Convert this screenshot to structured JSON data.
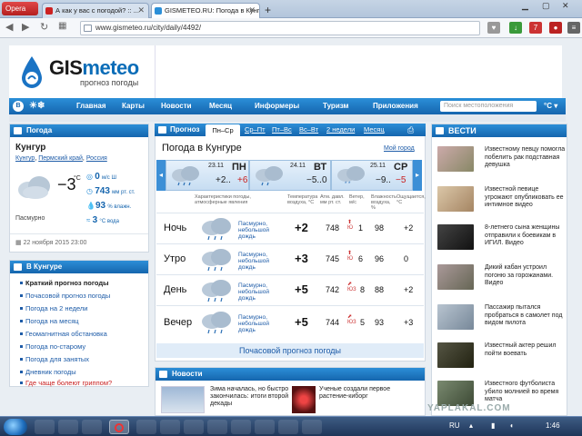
{
  "browser": {
    "opera_label": "Opera",
    "tabs": [
      {
        "title": "А как у вас с погодой? :: ..."
      },
      {
        "title": "GISMETEO.RU: Погода в Кунгуре"
      }
    ],
    "url": "www.gismeteo.ru/city/daily/4492/",
    "new_tab": "+",
    "ext_badge": "7"
  },
  "site": {
    "logo_main": "GIS",
    "logo_accent": "meteo",
    "logo_sub": "прогноз погоды",
    "menu": [
      "Главная",
      "Карты",
      "Новости",
      "Месяц",
      "Информеры",
      "Туризм",
      "Приложения"
    ],
    "search_placeholder": "Поиск местоположения",
    "unit_select": "°C ▾"
  },
  "current": {
    "header": "Погода",
    "city": "Кунгур",
    "region_links": [
      "Кунгур",
      "Пермский край",
      "Россия"
    ],
    "temp": "−3",
    "temp_unit": "°C",
    "wind_value": "0",
    "wind_unit": "м/с  Ш",
    "pressure_value": "743",
    "pressure_unit": "мм рт. ст.",
    "humidity_value": "93",
    "humidity_unit": "% влажн.",
    "water_value": "3",
    "water_unit": "°C вода",
    "desc": "Пасмурно",
    "date": "22 ноября 2015 23:00"
  },
  "city_block": {
    "header": "В Кунгуре",
    "items": [
      {
        "label": "Краткий прогноз погоды",
        "bold": true
      },
      {
        "label": "Почасовой прогноз погоды"
      },
      {
        "label": "Погода на 2 недели"
      },
      {
        "label": "Погода на месяц"
      },
      {
        "label": "Геомагнитная обстановка"
      },
      {
        "label": "Погода по-старому"
      },
      {
        "label": "Погода для занятых"
      },
      {
        "label": "Дневник погоды"
      },
      {
        "label": "Где чаще болеют гриппом?",
        "red": true
      }
    ]
  },
  "forecast": {
    "header": "Прогноз",
    "tabs": [
      "Пн–Ср",
      "Ср–Пт",
      "Пт–Вс",
      "Вс–Вт",
      "2 недели",
      "Месяц"
    ],
    "title": "Погода в Кунгуре",
    "my_weather": "Мой город",
    "days": [
      {
        "date": "23.11",
        "dow": "ПН",
        "hi": "+2..",
        "lo": "+6"
      },
      {
        "date": "24.11",
        "dow": "ВТ",
        "hi": "",
        "lo": "−5..0"
      },
      {
        "date": "25.11",
        "dow": "СР",
        "hi": "−9..",
        "lo": "−5"
      }
    ],
    "columns": {
      "desc": "Характеристики погоды, атмосферные явления",
      "temp": "Температура воздуха, °C",
      "pressure": "Атм. давл. мм рт. ст.",
      "wind": "Ветер, м/с",
      "humidity": "Влажность воздуха, %",
      "feel": "Ощущается, °C"
    },
    "rows": [
      {
        "name": "Ночь",
        "desc": "Пасмурно, небольшой дождь",
        "temp": "+2",
        "pressure": "748",
        "wind": "1",
        "wind_dir": "Ю",
        "humidity": "98",
        "feel": "+2"
      },
      {
        "name": "Утро",
        "desc": "Пасмурно, небольшой дождь",
        "temp": "+3",
        "pressure": "745",
        "wind": "6",
        "wind_dir": "Ю",
        "humidity": "96",
        "feel": "0"
      },
      {
        "name": "День",
        "desc": "Пасмурно, небольшой дождь",
        "temp": "+5",
        "pressure": "742",
        "wind": "8",
        "wind_dir": "ЮЗ",
        "humidity": "88",
        "feel": "+2"
      },
      {
        "name": "Вечер",
        "desc": "Пасмурно, небольшой дождь",
        "temp": "+5",
        "pressure": "744",
        "wind": "5",
        "wind_dir": "ЮЗ",
        "humidity": "93",
        "feel": "+3"
      }
    ],
    "hourly_link": "Почасовой прогноз погоды"
  },
  "news_block": {
    "header": "Новости",
    "items": [
      {
        "text": "Зима началась, но быстро закончилась: итоги второй декады"
      },
      {
        "text": "Ученые создали первое растение-киборг"
      }
    ]
  },
  "vesti": {
    "header": "ВЕСТИ",
    "items": [
      {
        "text": "Известному певцу помогла побелить рак подставная девушка"
      },
      {
        "text": "Известной певице угрожают опубликовать ее интимное видео"
      },
      {
        "text": "8-летнего сына женщины отправили к боевикам в ИГИЛ. Видео"
      },
      {
        "text": "Дикий кабан устроил погоню за горожанами. Видео"
      },
      {
        "text": "Пассажир пытался пробраться в самолет под видом пилота"
      },
      {
        "text": "Известный актер решил пойти воевать"
      },
      {
        "text": "Известного футболиста убило молнией во время матча"
      }
    ]
  },
  "taskbar": {
    "lang": "RU",
    "time": "1:46"
  },
  "watermark": "YAPLAKAL.COM"
}
